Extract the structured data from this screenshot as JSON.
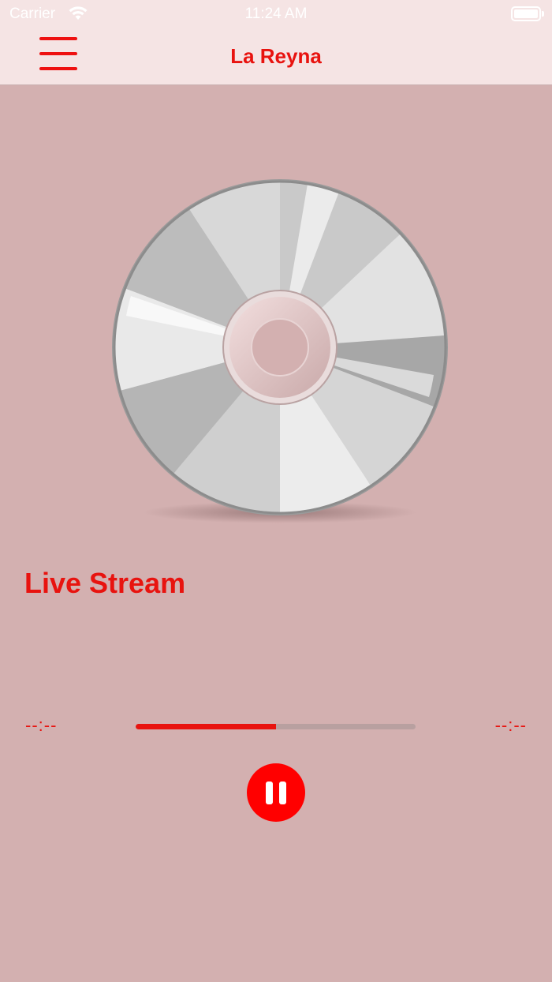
{
  "status_bar": {
    "carrier": "Carrier",
    "time": "11:24 AM"
  },
  "nav_bar": {
    "title": "La Reyna",
    "menu_icon": "hamburger-menu-icon"
  },
  "player": {
    "artwork_icon": "compact-disc-icon",
    "stream_title": "Live Stream",
    "elapsed_time": "--:--",
    "remaining_time": "--:--",
    "progress": 0.5,
    "play_state_icon": "pause-icon"
  },
  "colors": {
    "accent": "#e8130f",
    "nav_background": "#f5e4e4",
    "background": "#d3b0b0"
  }
}
